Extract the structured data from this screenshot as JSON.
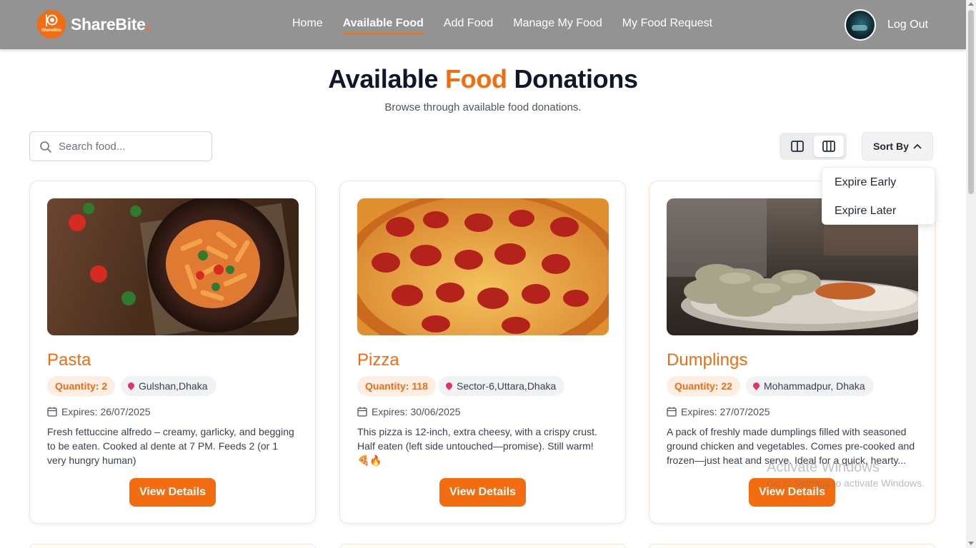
{
  "navbar": {
    "logo_mini": "ShareBite",
    "brand": "ShareBite",
    "links": [
      "Home",
      "Available Food",
      "Add Food",
      "Manage My Food",
      "My Food Request"
    ],
    "active_link": "Available Food",
    "logout": "Log Out"
  },
  "page": {
    "title_part1": "Available",
    "title_accent": "Food",
    "title_part2": "Donations",
    "subtitle": "Browse through available food donations."
  },
  "search": {
    "placeholder": "Search food...",
    "value": ""
  },
  "sort": {
    "label": "Sort By",
    "options": [
      "Expire Early",
      "Expire Later"
    ]
  },
  "cards": [
    {
      "name": "Pasta",
      "quantity": "Quantity: 2",
      "location": "Gulshan,Dhaka",
      "expires": "Expires: 26/07/2025",
      "description": "Fresh fettuccine alfredo – creamy, garlicky, and begging to be eaten. Cooked al dente at 7 PM. Feeds 2 (or 1 very hungry human)",
      "button": "View Details"
    },
    {
      "name": "Pizza",
      "quantity": "Quantity: 118",
      "location": "Sector-6,Uttara,Dhaka",
      "expires": "Expires: 30/06/2025",
      "description": "This pizza is 12-inch, extra cheesy, with a crispy crust. Half eaten (left side untouched—promise). Still warm! 🍕🔥",
      "button": "View Details"
    },
    {
      "name": "Dumplings",
      "quantity": "Quantity: 22",
      "location": "Mohammadpur, Dhaka",
      "expires": "Expires: 27/07/2025",
      "description": "A pack of freshly made dumplings filled with seasoned ground chicken and vegetables. Comes pre-cooked and frozen—just heat and serve. Ideal for a quick, hearty...",
      "button": "View Details"
    }
  ],
  "watermark": {
    "line1": "Activate Windows",
    "line2": "Go to Settings to activate Windows."
  },
  "colors": {
    "accent": "#f46c10",
    "navbar": "#939393",
    "heading": "#0f172a"
  }
}
